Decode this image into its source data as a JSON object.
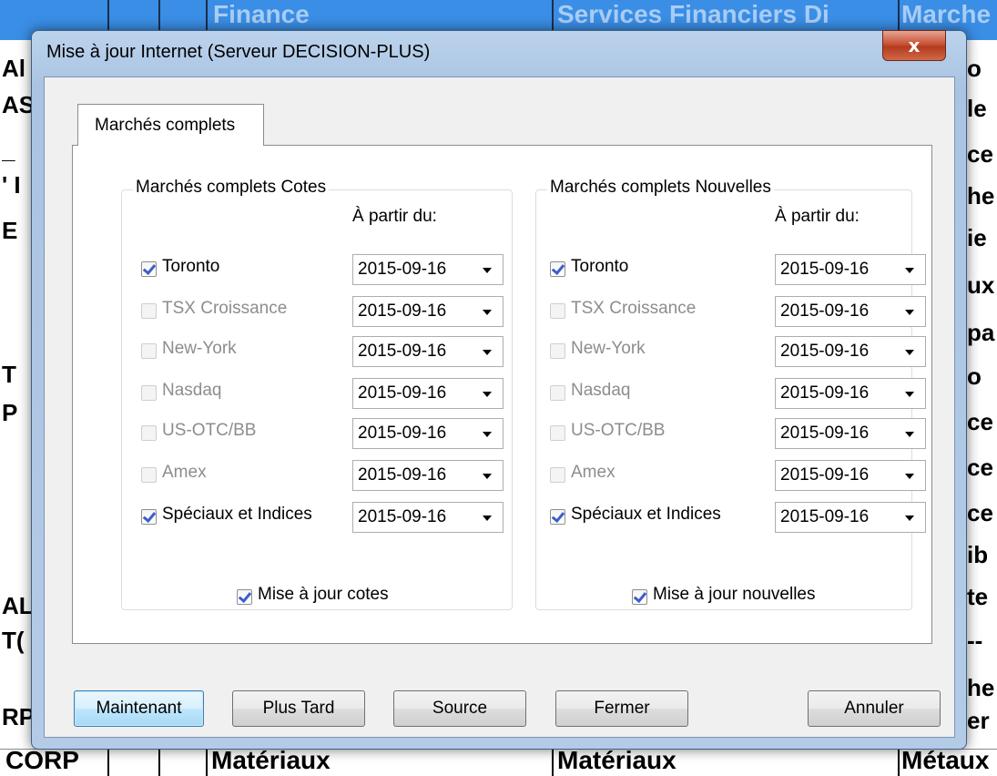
{
  "background": {
    "header_cells": [
      "Finance",
      "Services Financiers Di",
      "Marche"
    ],
    "left_fragments": [
      "Al",
      "AS",
      "_",
      "' I",
      "E",
      "T",
      "P",
      "AL",
      "T(",
      "RP"
    ],
    "right_fragments": [
      "o",
      "le",
      "ce",
      "he",
      "ie",
      "ux",
      "pa",
      "o",
      "ce",
      "ce",
      "ce",
      "ib",
      "te",
      "--",
      "he",
      "er"
    ],
    "bottom_cells": [
      "CORP",
      "Matériaux",
      "Matériaux",
      "Métaux"
    ]
  },
  "window": {
    "title": "Mise à jour Internet (Serveur DECISION-PLUS)",
    "close_glyph": "x"
  },
  "tab": {
    "label": "Marchés complets"
  },
  "groups": {
    "cotes": {
      "title": "Marchés complets Cotes",
      "date_header": "À partir du:",
      "rows": [
        {
          "label": "Toronto",
          "checked": true,
          "enabled": true,
          "date": "2015-09-16"
        },
        {
          "label": "TSX Croissance",
          "checked": false,
          "enabled": false,
          "date": "2015-09-16"
        },
        {
          "label": "New-York",
          "checked": false,
          "enabled": false,
          "date": "2015-09-16"
        },
        {
          "label": "Nasdaq",
          "checked": false,
          "enabled": false,
          "date": "2015-09-16"
        },
        {
          "label": "US-OTC/BB",
          "checked": false,
          "enabled": false,
          "date": "2015-09-16"
        },
        {
          "label": "Amex",
          "checked": false,
          "enabled": false,
          "date": "2015-09-16"
        },
        {
          "label": "Spéciaux et Indices",
          "checked": true,
          "enabled": true,
          "date": "2015-09-16"
        }
      ],
      "update_label": "Mise à jour cotes",
      "update_checked": true
    },
    "nouvelles": {
      "title": "Marchés complets Nouvelles",
      "date_header": "À partir du:",
      "rows": [
        {
          "label": "Toronto",
          "checked": true,
          "enabled": true,
          "date": "2015-09-16"
        },
        {
          "label": "TSX Croissance",
          "checked": false,
          "enabled": false,
          "date": "2015-09-16"
        },
        {
          "label": "New-York",
          "checked": false,
          "enabled": false,
          "date": "2015-09-16"
        },
        {
          "label": "Nasdaq",
          "checked": false,
          "enabled": false,
          "date": "2015-09-16"
        },
        {
          "label": "US-OTC/BB",
          "checked": false,
          "enabled": false,
          "date": "2015-09-16"
        },
        {
          "label": "Amex",
          "checked": false,
          "enabled": false,
          "date": "2015-09-16"
        },
        {
          "label": "Spéciaux et Indices",
          "checked": true,
          "enabled": true,
          "date": "2015-09-16"
        }
      ],
      "update_label": "Mise à jour nouvelles",
      "update_checked": true
    }
  },
  "buttons": {
    "now": "Maintenant",
    "later": "Plus Tard",
    "source": "Source",
    "close": "Fermer",
    "cancel": "Annuler"
  },
  "colors": {
    "check_mark": "#3d5ec8",
    "disabled_text": "#8d8d8d",
    "title_bar": "#bcd3ec",
    "close_button": "#c75234"
  }
}
